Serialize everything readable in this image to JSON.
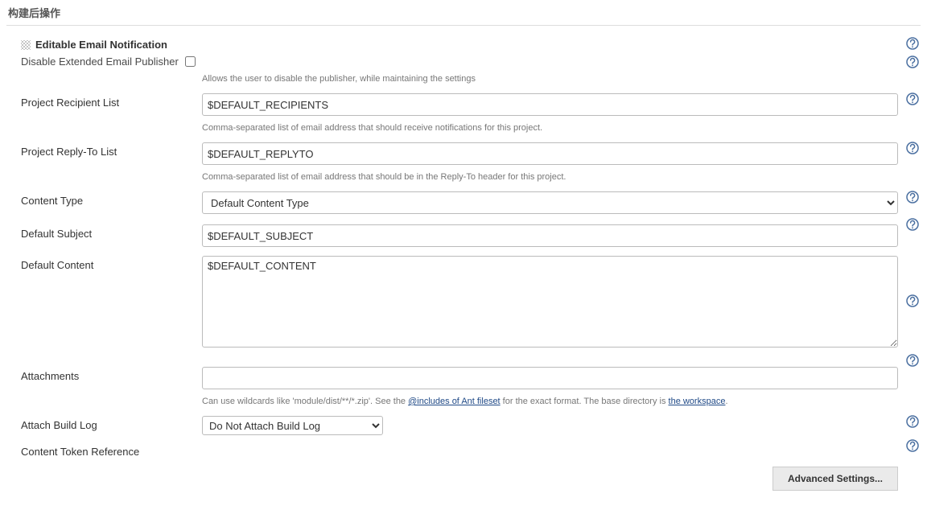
{
  "section": {
    "header": "构建后操作"
  },
  "block": {
    "title": "Editable Email Notification",
    "disable_publisher": {
      "label": "Disable Extended Email Publisher",
      "checked": false,
      "help": "Allows the user to disable the publisher, while maintaining the settings"
    },
    "recipient": {
      "label": "Project Recipient List",
      "value": "$DEFAULT_RECIPIENTS",
      "help": "Comma-separated list of email address that should receive notifications for this project."
    },
    "replyto": {
      "label": "Project Reply-To List",
      "value": "$DEFAULT_REPLYTO",
      "help": "Comma-separated list of email address that should be in the Reply-To header for this project."
    },
    "content_type": {
      "label": "Content Type",
      "value": "Default Content Type"
    },
    "subject": {
      "label": "Default Subject",
      "value": "$DEFAULT_SUBJECT"
    },
    "content": {
      "label": "Default Content",
      "value": "$DEFAULT_CONTENT"
    },
    "attachments": {
      "label": "Attachments",
      "value": "",
      "help_pre": "Can use wildcards like 'module/dist/**/*.zip'. See the ",
      "help_link1": "@includes of Ant fileset",
      "help_mid": " for the exact format. The base directory is ",
      "help_link2": "the workspace",
      "help_post": "."
    },
    "attach_log": {
      "label": "Attach Build Log",
      "value": "Do Not Attach Build Log"
    },
    "token_ref": {
      "label": "Content Token Reference"
    },
    "advanced_btn": "Advanced Settings..."
  }
}
